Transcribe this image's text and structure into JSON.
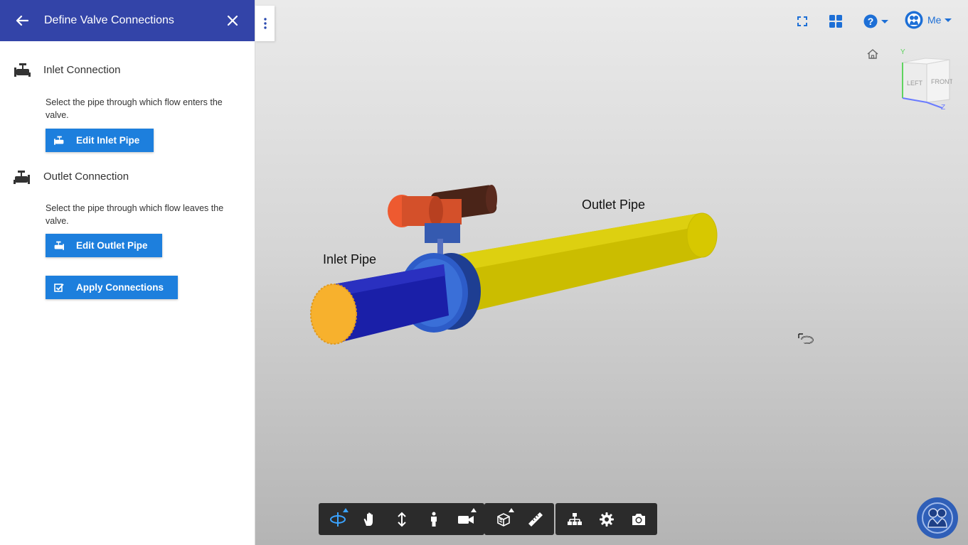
{
  "panel": {
    "title": "Define Valve Connections",
    "inlet": {
      "heading": "Inlet Connection",
      "description": "Select the pipe through which flow enters the valve.",
      "button": "Edit Inlet Pipe"
    },
    "outlet": {
      "heading": "Outlet Connection",
      "description": "Select the pipe through which flow leaves the valve.",
      "button": "Edit Outlet Pipe"
    },
    "apply_button": "Apply Connections"
  },
  "header": {
    "user_label": "Me"
  },
  "viewcube": {
    "left": "LEFT",
    "front": "FRONT",
    "y": "Y",
    "z": "Z"
  },
  "scene": {
    "inlet_label": "Inlet Pipe",
    "outlet_label": "Outlet Pipe"
  },
  "icons": {
    "back": "arrow-left-icon",
    "close": "close-icon",
    "more": "more-vertical-icon",
    "fullscreen": "fullscreen-icon",
    "layout": "grid-layout-icon",
    "help": "help-icon",
    "home": "home-icon",
    "user": "user-avatar-icon",
    "toolbar": [
      "orbit-icon",
      "pan-icon",
      "zoom-icon",
      "first-person-icon",
      "camera-icon",
      "section-icon",
      "measure-icon",
      "model-browser-icon",
      "settings-icon",
      "screenshot-icon"
    ]
  },
  "colors": {
    "header_bg": "#3344a8",
    "button_bg": "#1d7fdd",
    "inlet_pipe": "#1a1fa8",
    "outlet_pipe": "#d4c400",
    "inlet_face": "#f7b12d",
    "accent": "#1d6fd6"
  }
}
